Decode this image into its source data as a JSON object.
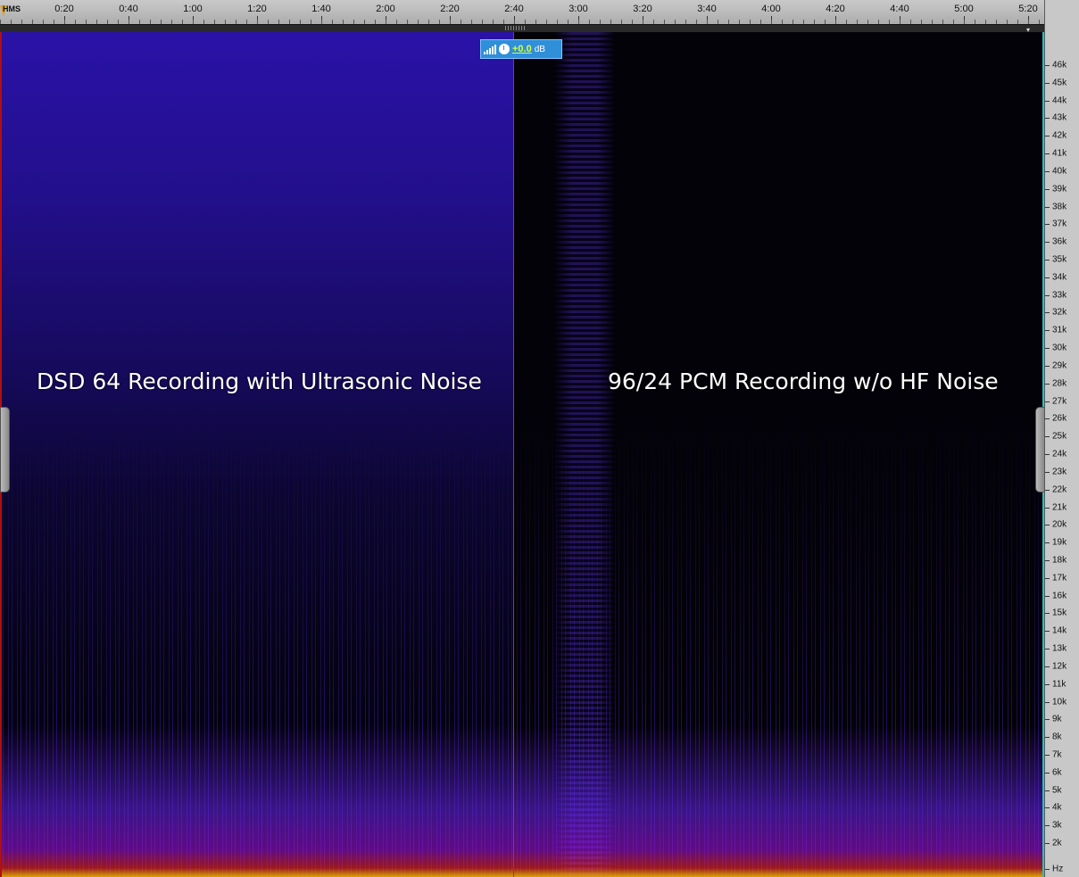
{
  "timeline": {
    "unit_label": "HMS",
    "ticks": [
      "0:20",
      "0:40",
      "1:00",
      "1:20",
      "1:40",
      "2:00",
      "2:20",
      "2:40",
      "3:00",
      "3:20",
      "3:40",
      "4:00",
      "4:20",
      "4:40",
      "5:00",
      "5:20"
    ]
  },
  "hud": {
    "db_value": "+0.0",
    "db_unit": "dB"
  },
  "annotations": {
    "left": "DSD 64 Recording with Ultrasonic Noise",
    "right": "96/24 PCM Recording w/o HF Noise"
  },
  "frequency_axis": {
    "labels": [
      "46k",
      "45k",
      "44k",
      "43k",
      "42k",
      "41k",
      "40k",
      "39k",
      "38k",
      "37k",
      "36k",
      "35k",
      "34k",
      "33k",
      "32k",
      "31k",
      "30k",
      "29k",
      "28k",
      "27k",
      "26k",
      "25k",
      "24k",
      "23k",
      "22k",
      "21k",
      "20k",
      "19k",
      "18k",
      "17k",
      "16k",
      "15k",
      "14k",
      "13k",
      "12k",
      "11k",
      "10k",
      "9k",
      "8k",
      "7k",
      "6k",
      "5k",
      "4k",
      "3k",
      "2k",
      "Hz"
    ]
  },
  "icons": {
    "level": "signal-bars-icon",
    "clock": "clock-icon",
    "marker": "playhead-marker-icon"
  },
  "colors": {
    "cursor": "#e02020",
    "hud_bg": "#2f8fd8",
    "db_text": "#d8ff40",
    "axis_rule": "#24c4c4"
  }
}
